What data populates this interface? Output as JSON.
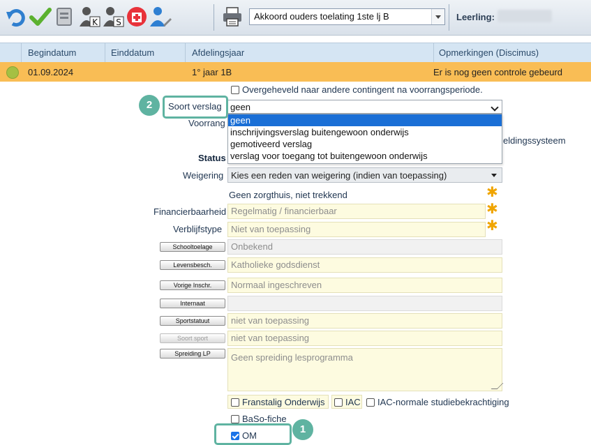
{
  "toolbar": {
    "icons": [
      "undo-icon",
      "checkmark-icon",
      "book-icon",
      "person-k-icon",
      "person-s-icon",
      "hospital-icon",
      "user-edit-icon",
      "printer-icon"
    ],
    "document_select": "Akkoord ouders toelating 1ste lj B",
    "leerling_label": "Leerling:"
  },
  "grid": {
    "headers": [
      "Begindatum",
      "Einddatum",
      "Afdelingsjaar",
      "Opmerkingen (Discimus)"
    ],
    "row": {
      "begindatum": "01.09.2024",
      "einddatum": "",
      "afdelingsjaar": "1° jaar 1B",
      "opmerkingen": "Er is nog geen controle gebeurd"
    }
  },
  "form": {
    "overgeheveld": "Overgeheveld naar andere contingent na voorrangsperiode.",
    "soort_verslag_label": "Soort verslag",
    "soort_verslag_value": "geen",
    "dropdown_options": [
      "geen",
      "inschrijvingsverslag buitengewoon onderwijs",
      "gemotiveerd verslag",
      "verslag voor toegang tot buitengewoon onderwijs"
    ],
    "voorrang_label": "Voorrang",
    "meldingssysteem_fragment": "eldingssysteem",
    "status_label": "Status",
    "weigering_label": "Weigering",
    "weigering_value": "Kies een reden van weigering (indien van toepassing)",
    "zorgthuis_text": "Geen zorgthuis, niet trekkend",
    "financierbaarheid_label": "Financierbaarheid",
    "financierbaarheid_value": "Regelmatig / financierbaar",
    "verblijfstype_label": "Verblijfstype",
    "verblijfstype_value": "Niet van toepassing",
    "schooltoelage_btn": "Schooltoelage",
    "schooltoelage_value": "Onbekend",
    "levensbesch_btn": "Levensbesch.",
    "levensbesch_value": "Katholieke godsdienst",
    "vorige_inschr_btn": "Vorige Inschr.",
    "vorige_inschr_value": "Normaal ingeschreven",
    "internaat_btn": "Internaat",
    "internaat_value": "",
    "sportstatuut_btn": "Sportstatuut",
    "sportstatuut_value": "niet van toepassing",
    "soort_sport_btn": "Soort sport",
    "soort_sport_value": "niet van toepassing",
    "spreiding_btn": "Spreiding LP",
    "spreiding_value": "Geen spreiding lesprogramma",
    "franstalig": "Franstalig Onderwijs",
    "iac": "IAC",
    "iac_normale": "IAC-normale studiebekrachtiging",
    "baso": "BaSo-fiche",
    "om": "OM"
  },
  "annotations": {
    "badge_1": "1",
    "badge_2": "2"
  },
  "colors": {
    "row_highlight": "#f9bd55",
    "header_bg": "#d5e5f3",
    "annotation": "#5fb3a1",
    "required_star": "#f0a500"
  }
}
